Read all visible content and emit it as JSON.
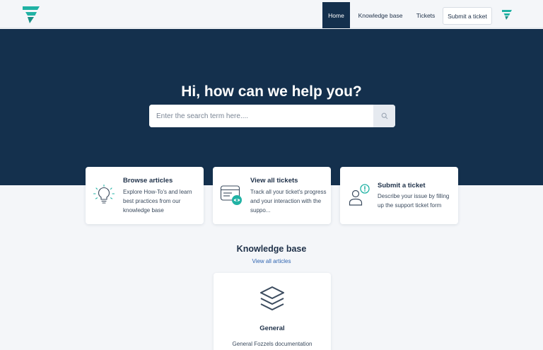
{
  "header": {
    "nav": {
      "home": "Home",
      "knowledge_base": "Knowledge base",
      "tickets": "Tickets",
      "submit": "Submit a ticket"
    }
  },
  "hero": {
    "title": "Hi, how can we help you?",
    "search_placeholder": "Enter the search term here...."
  },
  "cards": [
    {
      "title": "Browse articles",
      "desc": "Explore How-To's and learn best practices from our knowledge base",
      "icon": "lightbulb-icon"
    },
    {
      "title": "View all tickets",
      "desc": "Track all your ticket's progress and your interaction with the suppo...",
      "icon": "ticket-view-icon"
    },
    {
      "title": "Submit a ticket",
      "desc": "Describe your issue by filling up the support ticket form",
      "icon": "user-alert-icon"
    }
  ],
  "knowledge_base": {
    "title": "Knowledge base",
    "view_all": "View all articles",
    "category": {
      "title": "General",
      "desc": "General Fozzels documentation",
      "icon": "layers-icon"
    }
  },
  "colors": {
    "brand_navy": "#14304d",
    "accent_teal": "#20b2a4",
    "page_bg": "#f4f6f9"
  }
}
